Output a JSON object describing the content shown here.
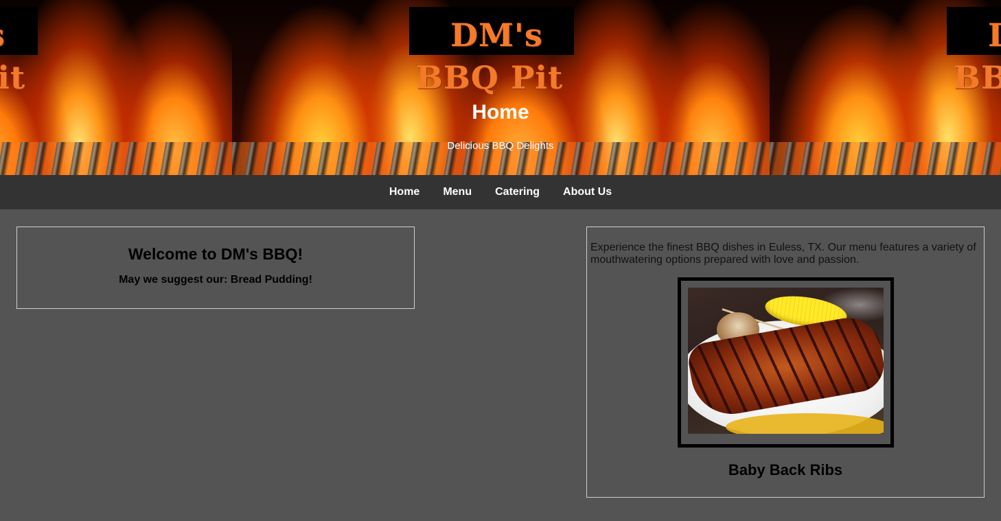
{
  "header": {
    "logo_line1": "DM's",
    "logo_line2": "BBQ Pit",
    "title": "Home",
    "subtitle": "Delicious BBQ Delights"
  },
  "nav": {
    "items": [
      {
        "label": "Home"
      },
      {
        "label": "Menu"
      },
      {
        "label": "Catering"
      },
      {
        "label": "About Us"
      }
    ]
  },
  "welcome": {
    "title": "Welcome to DM's BBQ!",
    "suggestion": "May we suggest our: Bread Pudding!"
  },
  "feature": {
    "description": "Experience the finest BBQ dishes in Euless, TX. Our menu features a variety of mouthwatering options prepared with love and passion.",
    "image_alt": "Baby Back Ribs",
    "caption": "Baby Back Ribs"
  },
  "colors": {
    "page_background": "#545454",
    "nav_background": "#333333",
    "logo_orange": "#f47a2a"
  }
}
